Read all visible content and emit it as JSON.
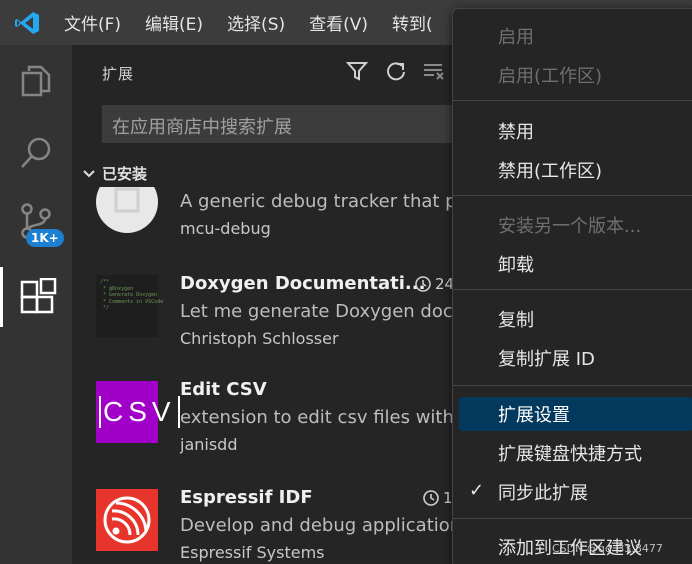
{
  "menubar": {
    "items": [
      "文件(F)",
      "编辑(E)",
      "选择(S)",
      "查看(V)",
      "转到("
    ]
  },
  "activity_bar": {
    "badge": "1K+"
  },
  "sidebar": {
    "title": "扩展",
    "search_placeholder": "在应用商店中搜索扩展",
    "section_title": "已安装",
    "extensions": [
      {
        "name": "",
        "description": "A generic debug tracker that pro",
        "publisher": "mcu-debug",
        "meta": ""
      },
      {
        "name": "Doxygen Documentati...",
        "description": "Let me generate Doxygen docu",
        "publisher": "Christoph Schlosser",
        "meta": "24",
        "icon_text": "/**\n * @Doxygen\n * Generate Doxygen\n * Comments in VSCode\n */"
      },
      {
        "name": "Edit CSV",
        "description": "extension to edit csv files with a",
        "publisher": "janisdd",
        "meta": "",
        "icon_text": "CSV"
      },
      {
        "name": "Espressif IDF",
        "description": "Develop and debug applications",
        "publisher": "Espressif Systems",
        "meta": "1"
      }
    ]
  },
  "context_menu": {
    "items": [
      {
        "label": "启用",
        "disabled": true
      },
      {
        "label": "启用(工作区)",
        "disabled": true
      },
      {
        "label": "禁用",
        "disabled": false
      },
      {
        "label": "禁用(工作区)",
        "disabled": false
      },
      {
        "label": "安装另一个版本...",
        "disabled": true
      },
      {
        "label": "卸载",
        "disabled": false
      },
      {
        "label": "复制",
        "disabled": false
      },
      {
        "label": "复制扩展 ID",
        "disabled": false
      },
      {
        "label": "扩展设置",
        "disabled": false,
        "selected": true
      },
      {
        "label": "扩展键盘快捷方式",
        "disabled": false
      },
      {
        "label": "同步此扩展",
        "disabled": false,
        "checked": true
      },
      {
        "label": "添加到工作区建议",
        "disabled": false
      }
    ]
  },
  "watermark": "CSDN @qq_33.8477",
  "colors": {
    "accent": "#007acc",
    "selection": "#04395e",
    "badge": "#1d7fd1"
  }
}
